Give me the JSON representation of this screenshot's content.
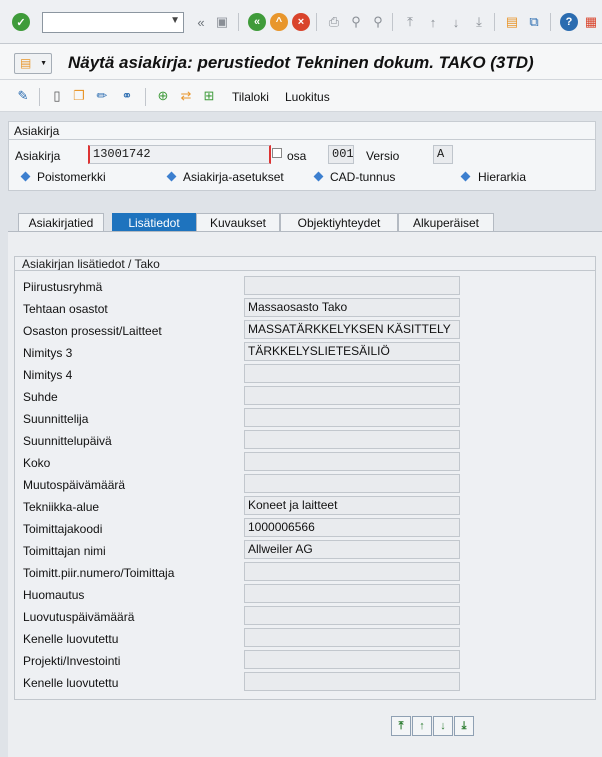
{
  "toolbar": {
    "command_value": "",
    "icons": [
      "check-icon",
      "back-icon",
      "exit-icon",
      "cancel-icon",
      "save-icon",
      "print-icon",
      "find-icon",
      "find-next-icon",
      "first-page-icon",
      "prev-page-icon",
      "next-page-icon",
      "last-page-icon",
      "new-session-icon",
      "shortcut-icon",
      "help-icon",
      "customize-icon"
    ],
    "colors": {
      "green": "#3f9b3a",
      "orange": "#e8962c",
      "red": "#d9442c"
    }
  },
  "title": "Näytä asiakirja: perustiedot Tekninen dokum. TAKO (3TD)",
  "app_toolbar": {
    "icons": [
      "display-change-icon",
      "new-document-icon",
      "copy-icon",
      "edit-icon",
      "binoculars-icon",
      "search-object-icon",
      "transfer-icon",
      "hierarchy-icon"
    ],
    "status_label": "Tilaloki",
    "classify_label": "Luokitus"
  },
  "header": {
    "section_title": "Asiakirja",
    "doc_label": "Asiakirja",
    "doc_value": "13001742",
    "part_label": "osa",
    "part_value": "001",
    "version_label": "Versio",
    "version_value": "A",
    "options": [
      "Poistomerkki",
      "Asiakirja-asetukset",
      "CAD-tunnus",
      "Hierarkia"
    ]
  },
  "tabs": [
    "Asiakirjatied",
    "Lisätiedot",
    "Kuvaukset",
    "Objektiyhteydet",
    "Alkuperäiset"
  ],
  "active_tab": "Lisätiedot",
  "group_title": "Asiakirjan lisätiedot / Tako",
  "fields": [
    {
      "label": "Piirustusryhmä",
      "value": ""
    },
    {
      "label": "Tehtaan osastot",
      "value": "Massaosasto Tako"
    },
    {
      "label": "Osaston prosessit/Laitteet",
      "value": "MASSATÄRKKELYKSEN KÄSITTELY"
    },
    {
      "label": "Nimitys 3",
      "value": "TÄRKKELYSLIETESÄILIÖ"
    },
    {
      "label": "Nimitys 4",
      "value": ""
    },
    {
      "label": "Suhde",
      "value": ""
    },
    {
      "label": "Suunnittelija",
      "value": ""
    },
    {
      "label": "Suunnittelupäivä",
      "value": ""
    },
    {
      "label": "Koko",
      "value": ""
    },
    {
      "label": "Muutospäivämäärä",
      "value": ""
    },
    {
      "label": "Tekniikka-alue",
      "value": "Koneet ja laitteet"
    },
    {
      "label": "Toimittajakoodi",
      "value": "1000006566"
    },
    {
      "label": "Toimittajan nimi",
      "value": "Allweiler AG"
    },
    {
      "label": "Toimitt.piir.numero/Toimittaja",
      "value": ""
    },
    {
      "label": "Huomautus",
      "value": ""
    },
    {
      "label": "Luovutuspäivämäärä",
      "value": ""
    },
    {
      "label": "Kenelle luovutettu",
      "value": ""
    },
    {
      "label": "Projekti/Investointi",
      "value": ""
    },
    {
      "label": "Kenelle luovutettu",
      "value": ""
    }
  ],
  "nav_icons": [
    "scroll-first-icon",
    "scroll-prev-icon",
    "scroll-next-icon",
    "scroll-last-icon"
  ]
}
